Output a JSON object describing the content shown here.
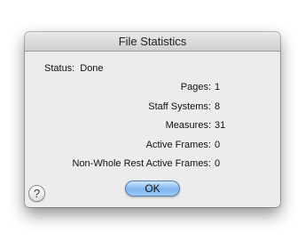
{
  "window": {
    "title": "File Statistics"
  },
  "status": {
    "label": "Status:",
    "value": "Done"
  },
  "stats": [
    {
      "label": "Pages:",
      "value": "1"
    },
    {
      "label": "Staff Systems:",
      "value": "8"
    },
    {
      "label": "Measures:",
      "value": "31"
    },
    {
      "label": "Active Frames:",
      "value": "0"
    },
    {
      "label": "Non-Whole Rest Active Frames:",
      "value": "0"
    }
  ],
  "buttons": {
    "help_label": "?",
    "ok_label": "OK"
  },
  "colors": {
    "ok_button": "#8cc0f3",
    "window_bg": "#ececec"
  }
}
